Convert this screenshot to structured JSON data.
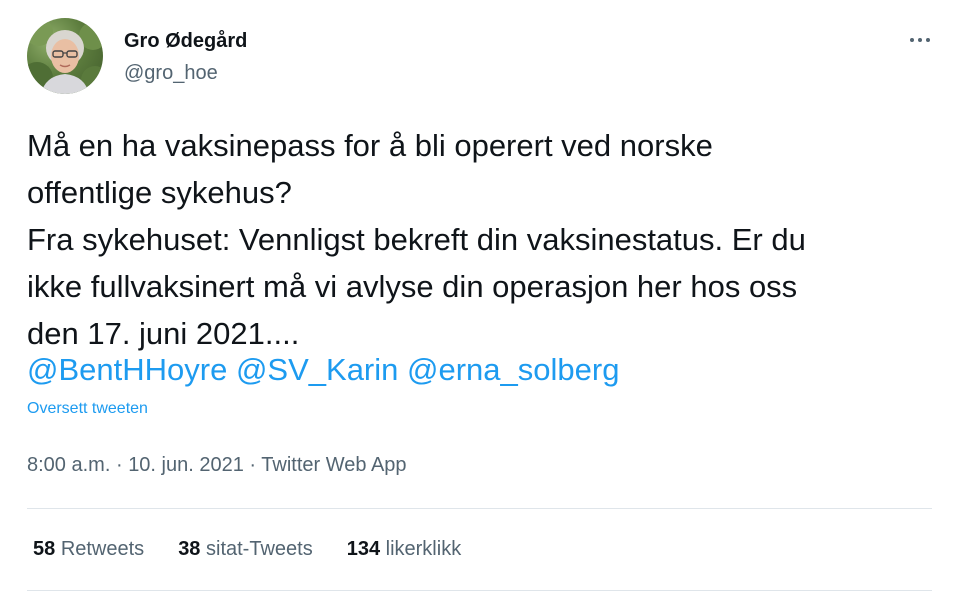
{
  "author": {
    "name": "Gro Ødegård",
    "handle": "@gro_hoe",
    "avatar_icon": "profile-photo"
  },
  "tweet": {
    "lines": [
      "Må en ha vaksinepass for å bli operert ved norske",
      "offentlige sykehus?",
      "Fra sykehuset: Vennligst bekreft din vaksinestatus. Er du",
      "ikke fullvaksinert må vi avlyse din operasjon her hos oss",
      "den 17. juni 2021...."
    ],
    "mentions": [
      "@BentHHoyre",
      "@SV_Karin",
      "@erna_solberg"
    ],
    "translate_label": "Oversett tweeten"
  },
  "meta": {
    "time": "8:00 a.m.",
    "separator": "·",
    "date": "10. jun. 2021",
    "source": "Twitter Web App"
  },
  "stats": {
    "retweets": {
      "count": "58",
      "label": "Retweets"
    },
    "quotes": {
      "count": "38",
      "label": "sitat-Tweets"
    },
    "likes": {
      "count": "134",
      "label": "likerklikk"
    }
  },
  "colors": {
    "link": "#1d9bf0",
    "text": "#0f1419",
    "muted": "#536471",
    "divider": "#dfe5ea"
  },
  "icons": {
    "more": "more-dots-icon"
  }
}
